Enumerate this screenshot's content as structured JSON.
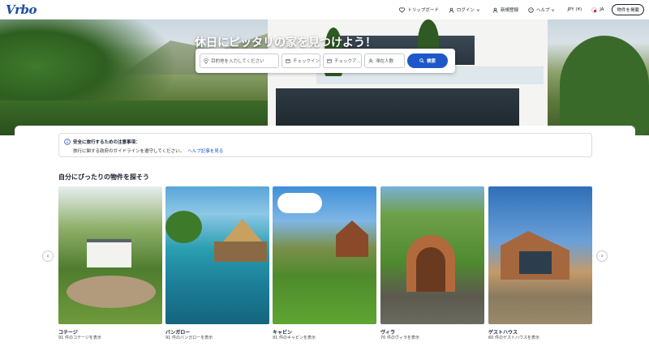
{
  "header": {
    "logo": "Vrbo",
    "nav": {
      "trip_board": "トリップボード",
      "login": "ログイン",
      "signup": "新規登録",
      "help": "ヘルプ",
      "currency": "JPY (¥)",
      "language": "JA",
      "list_property": "物件を掲載"
    }
  },
  "hero": {
    "title": "休日にピッタリの家を見つけよう！",
    "search": {
      "destination_placeholder": "目的地を入力してください",
      "checkin_label": "チェックイン",
      "checkout_label": "チェックア...",
      "guests_label": "滞在人数",
      "search_button": "検索"
    }
  },
  "notice": {
    "title": "安全に旅行するための注意事項：",
    "body": "旅行に関する政府のガイドラインを遵守してください。",
    "link": "ヘルプ記事を見る"
  },
  "section": {
    "title": "自分にぴったりの物件を探そう"
  },
  "cards": [
    {
      "label": "コテージ",
      "sub": "91 件のコテージを表示"
    },
    {
      "label": "バンガロー",
      "sub": "91 件のバンガローを表示"
    },
    {
      "label": "キャビン",
      "sub": "91 件のキャビンを表示"
    },
    {
      "label": "ヴィラ",
      "sub": "70 件のヴィラを表示"
    },
    {
      "label": "ゲストハウス",
      "sub": "60 件のゲストハウスを表示"
    }
  ],
  "carousel": {
    "prev": "‹",
    "next": "›"
  },
  "colors": {
    "brand": "#1c4fa1",
    "accent": "#1e57c7"
  },
  "icons": [
    "heart-icon",
    "user-icon",
    "user-add-icon",
    "help-icon",
    "flag-jp-icon",
    "pin-icon",
    "calendar-icon",
    "person-icon",
    "search-icon",
    "info-icon"
  ]
}
